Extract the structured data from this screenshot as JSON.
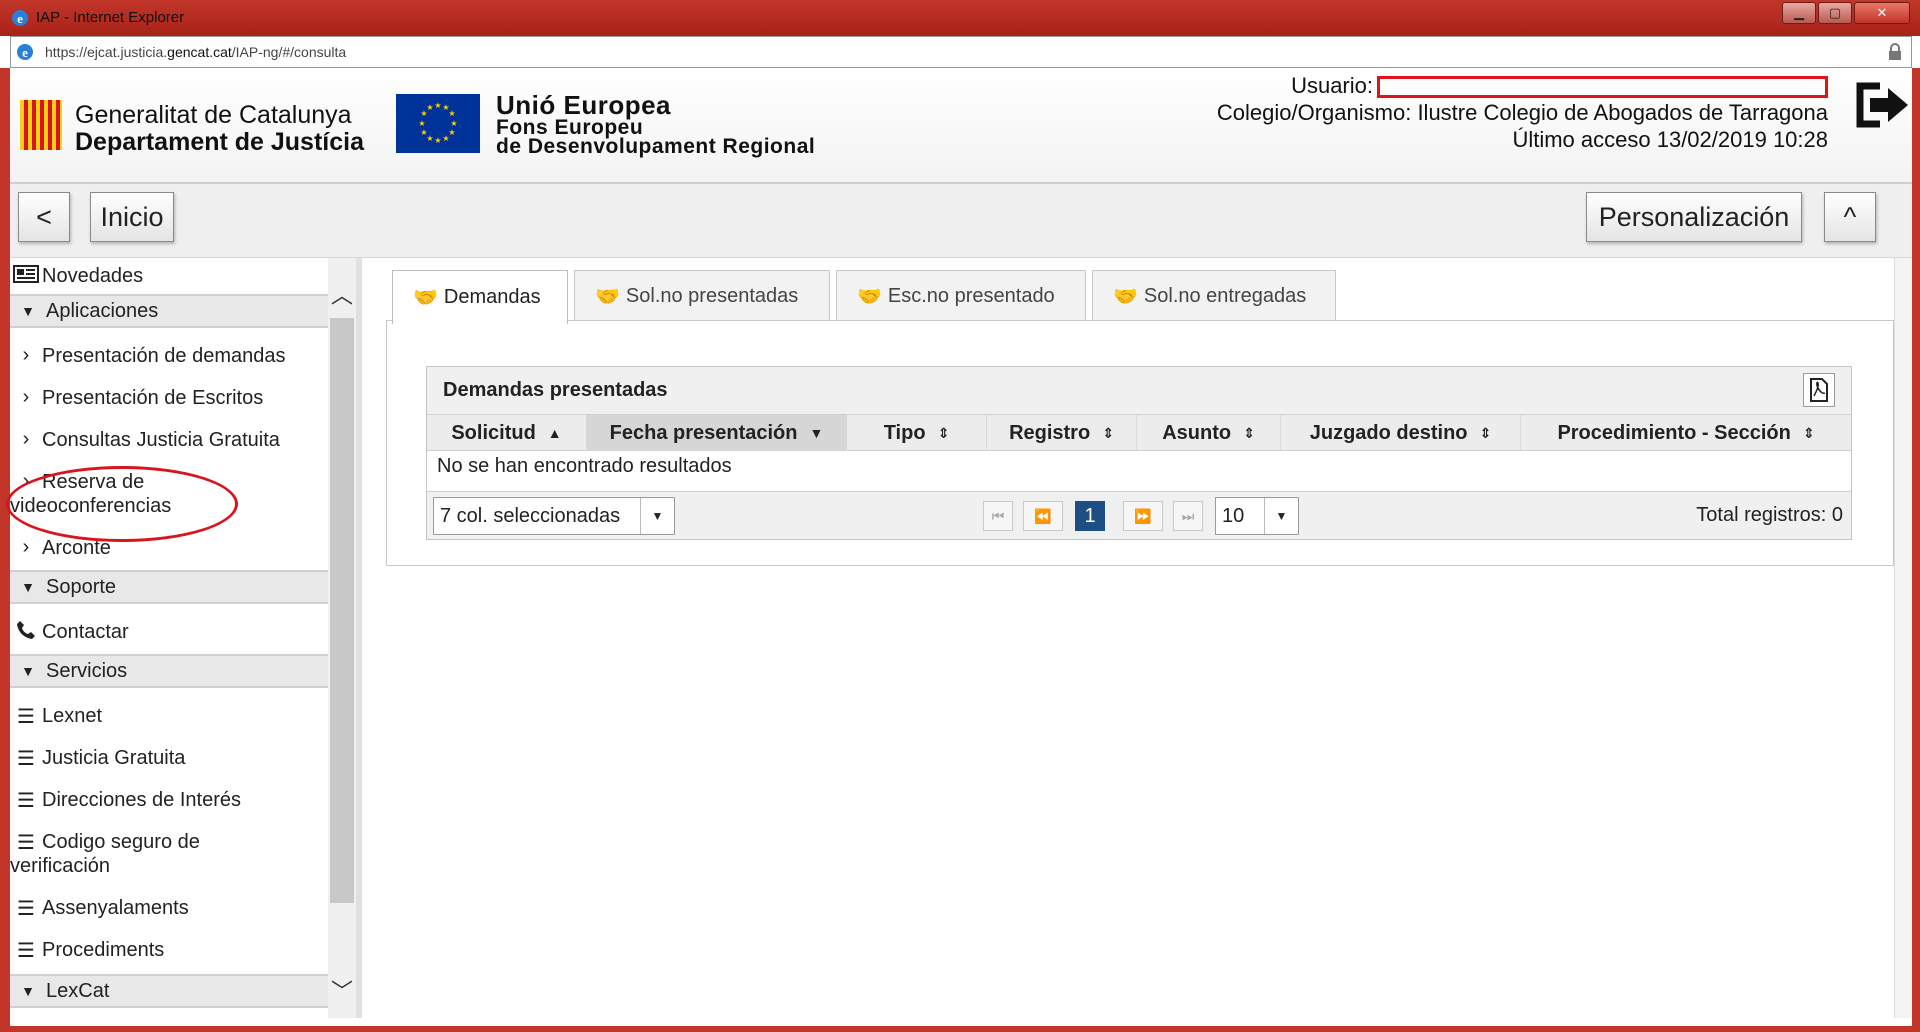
{
  "window": {
    "title": "IAP - Internet Explorer",
    "url_prefix": "https://ejcat.justicia.",
    "url_domain": "gencat.cat",
    "url_path": "/IAP-ng/#/consulta"
  },
  "header": {
    "gencat_line1": "Generalitat de Catalunya",
    "gencat_line2": "Departament de Justícia",
    "eu_line1": "Unió Europea",
    "eu_line2": "Fons Europeu",
    "eu_line3": "de Desenvolupament Regional",
    "user_label": "Usuario:",
    "colegio": "Colegio/Organismo: Ilustre Colegio de Abogados de Tarragona",
    "last_access": "Último acceso 13/02/2019 10:28"
  },
  "toolbar": {
    "back_glyph": "<",
    "home_label": "Inicio",
    "personalize_label": "Personalización",
    "collapse_glyph": "^"
  },
  "sidebar": {
    "novedades": "Novedades",
    "aplicaciones": "Aplicaciones",
    "app_items": [
      "Presentación de demandas",
      "Presentación de Escritos",
      "Consultas Justicia Gratuita",
      "Reserva de videoconferencias",
      "Arconte"
    ],
    "soporte": "Soporte",
    "contactar": "Contactar",
    "servicios": "Servicios",
    "serv_items": [
      "Lexnet",
      "Justicia Gratuita",
      "Direcciones de Interés",
      "Codigo seguro de verificación",
      "Assenyalaments",
      "Procediments"
    ],
    "lexcat": "LexCat"
  },
  "tabs": [
    "Demandas",
    "Sol.no presentadas",
    "Esc.no presentado",
    "Sol.no entregadas"
  ],
  "grid": {
    "title": "Demandas presentadas",
    "columns": [
      "Solicitud",
      "Fecha presentación",
      "Tipo",
      "Registro",
      "Asunto",
      "Juzgado destino",
      "Procedimiento - Sección"
    ],
    "empty_message": "No se han encontrado resultados",
    "columns_select": "7 col. seleccionadas",
    "current_page": "1",
    "page_size": "10",
    "total": "Total registros: 0"
  },
  "colors": {
    "window_frame": "#c2362a",
    "annotation": "#d9141d",
    "page_active": "#1e4f84",
    "eu_blue": "#003399",
    "eu_gold": "#ffcc00",
    "gencat_red": "#d8141d",
    "gencat_yellow": "#f7d117"
  }
}
